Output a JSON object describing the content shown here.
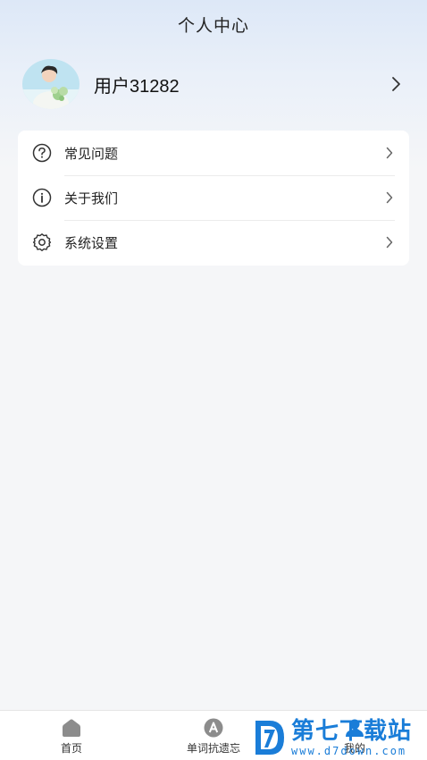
{
  "header": {
    "title": "个人中心"
  },
  "profile": {
    "username": "用户31282"
  },
  "menu": {
    "items": [
      {
        "label": "常见问题",
        "icon": "question-circle-icon"
      },
      {
        "label": "关于我们",
        "icon": "info-circle-icon"
      },
      {
        "label": "系统设置",
        "icon": "gear-icon"
      }
    ]
  },
  "tabbar": {
    "tabs": [
      {
        "label": "首页",
        "icon": "home-icon"
      },
      {
        "label": "单词抗遗忘",
        "icon": "letter-a-icon"
      },
      {
        "label": "我的",
        "icon": "user-icon"
      }
    ]
  },
  "watermark": {
    "title": "第七下载站",
    "url": "www.d7down.com"
  },
  "colors": {
    "accent": "#1a7dd8",
    "background": "#f5f6f8",
    "card": "#ffffff"
  }
}
